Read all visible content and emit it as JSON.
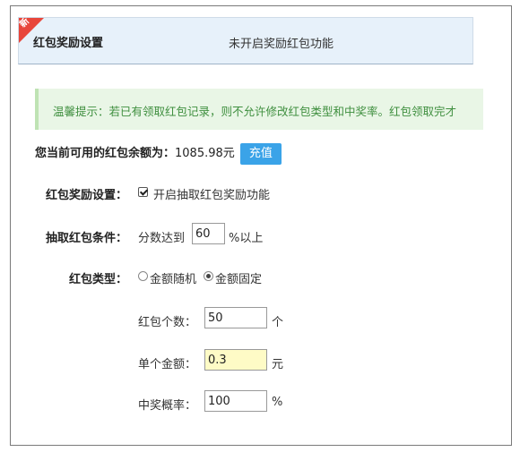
{
  "header": {
    "badge": "新",
    "title": "红包奖励设置",
    "status": "未开启奖励红包功能"
  },
  "notice": {
    "text": "温馨提示：若已有领取红包记录，则不允许修改红包类型和中奖率。红包领取完才"
  },
  "balance": {
    "label": "您当前可用的红包余额为：",
    "value": "1085.98元",
    "recharge_label": "充值"
  },
  "form": {
    "reward_setting": {
      "label": "红包奖励设置：",
      "checkbox_label": "开启抽取红包奖励功能",
      "checked": true
    },
    "condition": {
      "label": "抽取红包条件：",
      "prefix": "分数达到",
      "value": "60",
      "suffix": "%以上"
    },
    "type": {
      "label": "红包类型：",
      "options": [
        "金额随机",
        "金额固定"
      ],
      "selected": "金额固定"
    },
    "count": {
      "label": "红包个数：",
      "value": "50",
      "unit": "个"
    },
    "amount": {
      "label": "单个金额：",
      "value": "0.3",
      "unit": "元"
    },
    "probability": {
      "label": "中奖概率：",
      "value": "100",
      "unit": "%"
    }
  },
  "colors": {
    "header_bg": "#e7f1fa",
    "ribbon": "#e8463b",
    "notice_bg": "#e9f6e6",
    "notice_text": "#3f8f3f",
    "button": "#3aa3e8",
    "highlight_input": "#fefbc6"
  }
}
